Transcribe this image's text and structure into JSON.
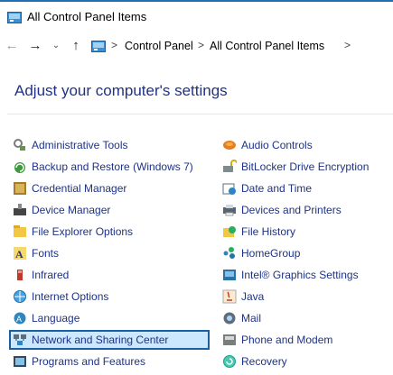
{
  "window": {
    "title": "All Control Panel Items"
  },
  "navigation": {
    "back_icon": "back-arrow-icon",
    "forward_icon": "forward-arrow-icon",
    "recent_icon": "chevron-down-icon",
    "up_icon": "up-arrow-icon",
    "breadcrumb": [
      "Control Panel",
      "All Control Panel Items"
    ],
    "separator": ">"
  },
  "main": {
    "heading": "Adjust your computer's settings",
    "left_items": [
      {
        "label": "Administrative Tools",
        "icon": "administrative-tools-icon"
      },
      {
        "label": "Backup and Restore (Windows 7)",
        "icon": "backup-restore-icon"
      },
      {
        "label": "Credential Manager",
        "icon": "credential-manager-icon"
      },
      {
        "label": "Device Manager",
        "icon": "device-manager-icon"
      },
      {
        "label": "File Explorer Options",
        "icon": "file-explorer-options-icon"
      },
      {
        "label": "Fonts",
        "icon": "fonts-icon"
      },
      {
        "label": "Infrared",
        "icon": "infrared-icon"
      },
      {
        "label": "Internet Options",
        "icon": "internet-options-icon"
      },
      {
        "label": "Language",
        "icon": "language-icon"
      },
      {
        "label": "Network and Sharing Center",
        "icon": "network-sharing-icon",
        "selected": true
      },
      {
        "label": "Programs and Features",
        "icon": "programs-features-icon"
      }
    ],
    "right_items": [
      {
        "label": "Audio Controls",
        "icon": "audio-controls-icon"
      },
      {
        "label": "BitLocker Drive Encryption",
        "icon": "bitlocker-icon"
      },
      {
        "label": "Date and Time",
        "icon": "date-time-icon"
      },
      {
        "label": "Devices and Printers",
        "icon": "devices-printers-icon"
      },
      {
        "label": "File History",
        "icon": "file-history-icon"
      },
      {
        "label": "HomeGroup",
        "icon": "homegroup-icon"
      },
      {
        "label": "Intel® Graphics Settings",
        "icon": "intel-graphics-icon"
      },
      {
        "label": "Java",
        "icon": "java-icon"
      },
      {
        "label": "Mail",
        "icon": "mail-icon"
      },
      {
        "label": "Phone and Modem",
        "icon": "phone-modem-icon"
      },
      {
        "label": "Recovery",
        "icon": "recovery-icon"
      }
    ]
  },
  "colors": {
    "link": "#1e3287",
    "selection_fill": "#cce8ff",
    "selection_border": "#1b5fa3",
    "title_accent": "#1f6fb5"
  }
}
